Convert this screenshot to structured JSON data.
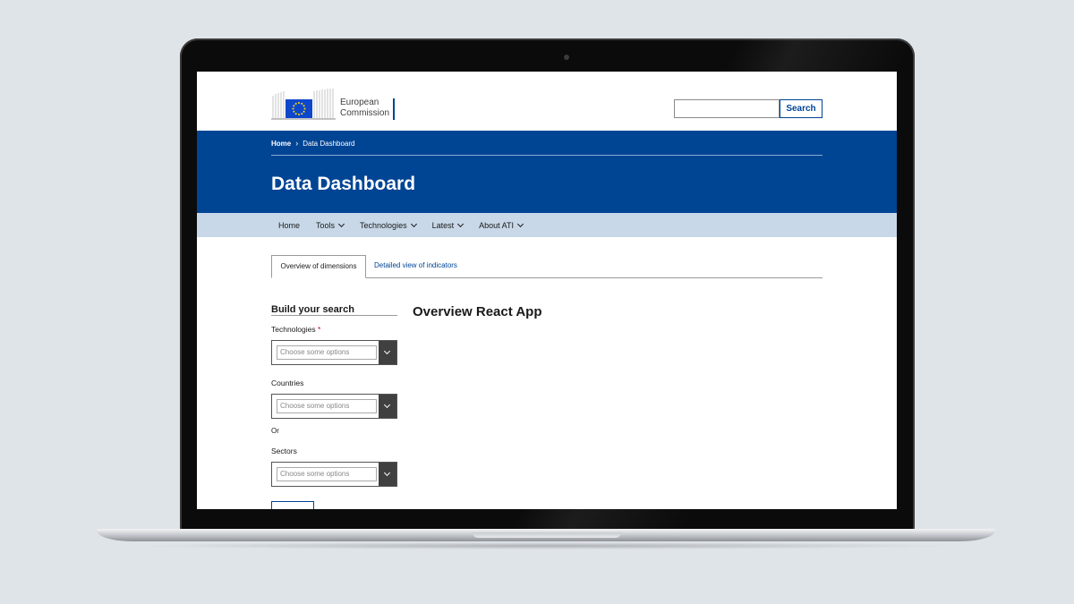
{
  "header": {
    "logo_line1": "European",
    "logo_line2": "Commission",
    "search_placeholder": "",
    "search_button": "Search"
  },
  "breadcrumb": {
    "home": "Home",
    "current": "Data Dashboard"
  },
  "page_title": "Data Dashboard",
  "nav": {
    "items": [
      {
        "label": "Home",
        "has_dropdown": false
      },
      {
        "label": "Tools",
        "has_dropdown": true
      },
      {
        "label": "Technologies",
        "has_dropdown": true
      },
      {
        "label": "Latest",
        "has_dropdown": true
      },
      {
        "label": "About ATI",
        "has_dropdown": true
      }
    ]
  },
  "tabs": {
    "active": "Overview of dimensions",
    "other": "Detailed view of indicators"
  },
  "filters": {
    "title": "Build your search",
    "technologies": {
      "label": "Technologies",
      "required_mark": "*",
      "placeholder": "Choose some options"
    },
    "countries": {
      "label": "Countries",
      "placeholder": "Choose some options"
    },
    "or_label": "Or",
    "sectors": {
      "label": "Sectors",
      "placeholder": "Choose some options"
    }
  },
  "main": {
    "heading": "Overview React App"
  },
  "colors": {
    "brand_blue": "#004494",
    "nav_bg": "#c8d8e8",
    "background": "#dfe4e9",
    "eu_flag": "#0e47cb"
  }
}
